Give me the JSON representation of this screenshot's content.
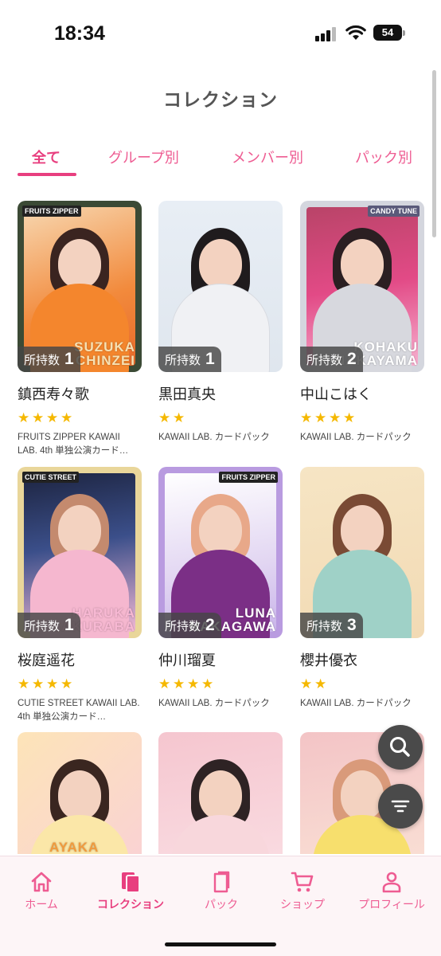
{
  "status_bar": {
    "time": "18:34",
    "battery": "54"
  },
  "page": {
    "title": "コレクション"
  },
  "tabs": [
    {
      "label": "全て",
      "active": true
    },
    {
      "label": "グループ別",
      "active": false
    },
    {
      "label": "メンバー別",
      "active": false
    },
    {
      "label": "パック別",
      "active": false
    }
  ],
  "owned_label": "所持数",
  "cards": [
    {
      "name": "鎮西寿々歌",
      "owned": "1",
      "stars": 4,
      "pack": "FRUITS ZIPPER KAWAII LAB. 4th 単独公演カード…",
      "card_text": "SUZUKA\nCHINZEI",
      "logo": "FRUITS ZIPPER"
    },
    {
      "name": "黒田真央",
      "owned": "1",
      "stars": 2,
      "pack": "KAWAII LAB. カードパック",
      "card_text": "",
      "logo": ""
    },
    {
      "name": "中山こはく",
      "owned": "2",
      "stars": 4,
      "pack": "KAWAII LAB. カードパック",
      "card_text": "KOHAKU\nNAKAYAMA",
      "logo": "CANDY TUNE"
    },
    {
      "name": "桜庭遥花",
      "owned": "1",
      "stars": 4,
      "pack": "CUTIE STREET KAWAII LAB. 4th 単独公演カード…",
      "card_text": "HARUKA\nSAKURABA",
      "logo": "CUTIE STREET"
    },
    {
      "name": "仲川瑠夏",
      "owned": "2",
      "stars": 4,
      "pack": "KAWAII LAB. カードパック",
      "card_text": "LUNA\nNAKAGAWA",
      "logo": "FRUITS ZIPPER"
    },
    {
      "name": "櫻井優衣",
      "owned": "3",
      "stars": 2,
      "pack": "KAWAII LAB. カードパック",
      "card_text": "",
      "logo": ""
    },
    {
      "name": "",
      "owned": "",
      "stars": 0,
      "pack": "",
      "card_text": "AYAKA",
      "logo": ""
    },
    {
      "name": "",
      "owned": "",
      "stars": 0,
      "pack": "",
      "card_text": "",
      "logo": ""
    },
    {
      "name": "",
      "owned": "",
      "stars": 0,
      "pack": "",
      "card_text": "",
      "logo": ""
    }
  ],
  "fabs": {
    "search": "search-icon",
    "filter": "filter-icon"
  },
  "nav": [
    {
      "label": "ホーム",
      "icon": "home-icon",
      "active": false
    },
    {
      "label": "コレクション",
      "icon": "collection-icon",
      "active": true
    },
    {
      "label": "パック",
      "icon": "pack-icon",
      "active": false
    },
    {
      "label": "ショップ",
      "icon": "cart-icon",
      "active": false
    },
    {
      "label": "プロフィール",
      "icon": "profile-icon",
      "active": false
    }
  ],
  "colors": {
    "accent": "#e83f7f",
    "accent_light": "#ee5c92",
    "star": "#f5b800",
    "nav_bg": "#fdf5f7"
  }
}
